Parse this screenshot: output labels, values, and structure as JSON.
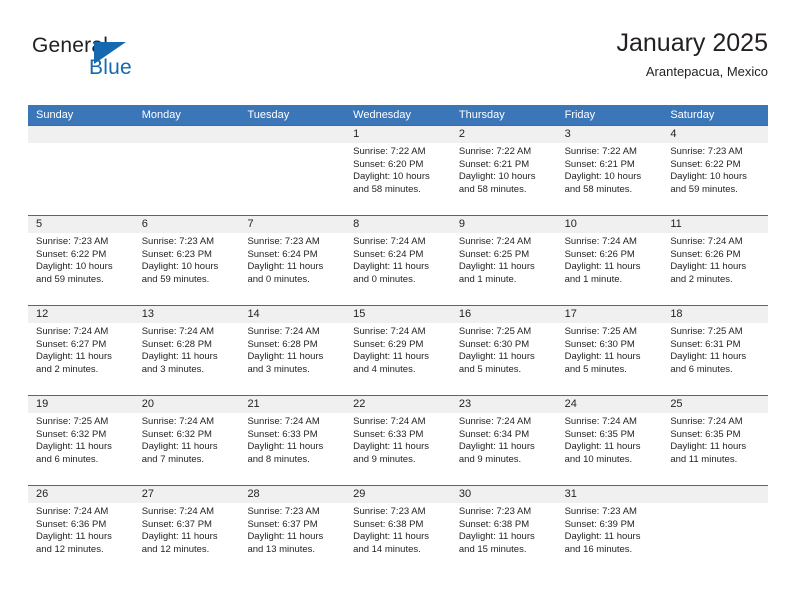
{
  "logo": {
    "text_top": "General",
    "text_bottom": "Blue",
    "triangle_icon": "triangle-icon",
    "brand_color": "#1668b0"
  },
  "header": {
    "title": "January 2025",
    "subtitle": "Arantepacua, Mexico"
  },
  "colors": {
    "header_blue": "#3a76b8",
    "row_divider_blue": "#2f6fb0",
    "day_band_gray": "#f0f0f0",
    "text": "#231f20"
  },
  "weekdays": [
    "Sunday",
    "Monday",
    "Tuesday",
    "Wednesday",
    "Thursday",
    "Friday",
    "Saturday"
  ],
  "weeks": [
    [
      {
        "day": "",
        "sunrise": "",
        "sunset": "",
        "daylight_line1": "",
        "daylight_line2": "",
        "empty": true
      },
      {
        "day": "",
        "sunrise": "",
        "sunset": "",
        "daylight_line1": "",
        "daylight_line2": "",
        "empty": true
      },
      {
        "day": "",
        "sunrise": "",
        "sunset": "",
        "daylight_line1": "",
        "daylight_line2": "",
        "empty": true
      },
      {
        "day": "1",
        "sunrise": "Sunrise: 7:22 AM",
        "sunset": "Sunset: 6:20 PM",
        "daylight_line1": "Daylight: 10 hours",
        "daylight_line2": "and 58 minutes.",
        "empty": false
      },
      {
        "day": "2",
        "sunrise": "Sunrise: 7:22 AM",
        "sunset": "Sunset: 6:21 PM",
        "daylight_line1": "Daylight: 10 hours",
        "daylight_line2": "and 58 minutes.",
        "empty": false
      },
      {
        "day": "3",
        "sunrise": "Sunrise: 7:22 AM",
        "sunset": "Sunset: 6:21 PM",
        "daylight_line1": "Daylight: 10 hours",
        "daylight_line2": "and 58 minutes.",
        "empty": false
      },
      {
        "day": "4",
        "sunrise": "Sunrise: 7:23 AM",
        "sunset": "Sunset: 6:22 PM",
        "daylight_line1": "Daylight: 10 hours",
        "daylight_line2": "and 59 minutes.",
        "empty": false
      }
    ],
    [
      {
        "day": "5",
        "sunrise": "Sunrise: 7:23 AM",
        "sunset": "Sunset: 6:22 PM",
        "daylight_line1": "Daylight: 10 hours",
        "daylight_line2": "and 59 minutes.",
        "empty": false
      },
      {
        "day": "6",
        "sunrise": "Sunrise: 7:23 AM",
        "sunset": "Sunset: 6:23 PM",
        "daylight_line1": "Daylight: 10 hours",
        "daylight_line2": "and 59 minutes.",
        "empty": false
      },
      {
        "day": "7",
        "sunrise": "Sunrise: 7:23 AM",
        "sunset": "Sunset: 6:24 PM",
        "daylight_line1": "Daylight: 11 hours",
        "daylight_line2": "and 0 minutes.",
        "empty": false
      },
      {
        "day": "8",
        "sunrise": "Sunrise: 7:24 AM",
        "sunset": "Sunset: 6:24 PM",
        "daylight_line1": "Daylight: 11 hours",
        "daylight_line2": "and 0 minutes.",
        "empty": false
      },
      {
        "day": "9",
        "sunrise": "Sunrise: 7:24 AM",
        "sunset": "Sunset: 6:25 PM",
        "daylight_line1": "Daylight: 11 hours",
        "daylight_line2": "and 1 minute.",
        "empty": false
      },
      {
        "day": "10",
        "sunrise": "Sunrise: 7:24 AM",
        "sunset": "Sunset: 6:26 PM",
        "daylight_line1": "Daylight: 11 hours",
        "daylight_line2": "and 1 minute.",
        "empty": false
      },
      {
        "day": "11",
        "sunrise": "Sunrise: 7:24 AM",
        "sunset": "Sunset: 6:26 PM",
        "daylight_line1": "Daylight: 11 hours",
        "daylight_line2": "and 2 minutes.",
        "empty": false
      }
    ],
    [
      {
        "day": "12",
        "sunrise": "Sunrise: 7:24 AM",
        "sunset": "Sunset: 6:27 PM",
        "daylight_line1": "Daylight: 11 hours",
        "daylight_line2": "and 2 minutes.",
        "empty": false
      },
      {
        "day": "13",
        "sunrise": "Sunrise: 7:24 AM",
        "sunset": "Sunset: 6:28 PM",
        "daylight_line1": "Daylight: 11 hours",
        "daylight_line2": "and 3 minutes.",
        "empty": false
      },
      {
        "day": "14",
        "sunrise": "Sunrise: 7:24 AM",
        "sunset": "Sunset: 6:28 PM",
        "daylight_line1": "Daylight: 11 hours",
        "daylight_line2": "and 3 minutes.",
        "empty": false
      },
      {
        "day": "15",
        "sunrise": "Sunrise: 7:24 AM",
        "sunset": "Sunset: 6:29 PM",
        "daylight_line1": "Daylight: 11 hours",
        "daylight_line2": "and 4 minutes.",
        "empty": false
      },
      {
        "day": "16",
        "sunrise": "Sunrise: 7:25 AM",
        "sunset": "Sunset: 6:30 PM",
        "daylight_line1": "Daylight: 11 hours",
        "daylight_line2": "and 5 minutes.",
        "empty": false
      },
      {
        "day": "17",
        "sunrise": "Sunrise: 7:25 AM",
        "sunset": "Sunset: 6:30 PM",
        "daylight_line1": "Daylight: 11 hours",
        "daylight_line2": "and 5 minutes.",
        "empty": false
      },
      {
        "day": "18",
        "sunrise": "Sunrise: 7:25 AM",
        "sunset": "Sunset: 6:31 PM",
        "daylight_line1": "Daylight: 11 hours",
        "daylight_line2": "and 6 minutes.",
        "empty": false
      }
    ],
    [
      {
        "day": "19",
        "sunrise": "Sunrise: 7:25 AM",
        "sunset": "Sunset: 6:32 PM",
        "daylight_line1": "Daylight: 11 hours",
        "daylight_line2": "and 6 minutes.",
        "empty": false
      },
      {
        "day": "20",
        "sunrise": "Sunrise: 7:24 AM",
        "sunset": "Sunset: 6:32 PM",
        "daylight_line1": "Daylight: 11 hours",
        "daylight_line2": "and 7 minutes.",
        "empty": false
      },
      {
        "day": "21",
        "sunrise": "Sunrise: 7:24 AM",
        "sunset": "Sunset: 6:33 PM",
        "daylight_line1": "Daylight: 11 hours",
        "daylight_line2": "and 8 minutes.",
        "empty": false
      },
      {
        "day": "22",
        "sunrise": "Sunrise: 7:24 AM",
        "sunset": "Sunset: 6:33 PM",
        "daylight_line1": "Daylight: 11 hours",
        "daylight_line2": "and 9 minutes.",
        "empty": false
      },
      {
        "day": "23",
        "sunrise": "Sunrise: 7:24 AM",
        "sunset": "Sunset: 6:34 PM",
        "daylight_line1": "Daylight: 11 hours",
        "daylight_line2": "and 9 minutes.",
        "empty": false
      },
      {
        "day": "24",
        "sunrise": "Sunrise: 7:24 AM",
        "sunset": "Sunset: 6:35 PM",
        "daylight_line1": "Daylight: 11 hours",
        "daylight_line2": "and 10 minutes.",
        "empty": false
      },
      {
        "day": "25",
        "sunrise": "Sunrise: 7:24 AM",
        "sunset": "Sunset: 6:35 PM",
        "daylight_line1": "Daylight: 11 hours",
        "daylight_line2": "and 11 minutes.",
        "empty": false
      }
    ],
    [
      {
        "day": "26",
        "sunrise": "Sunrise: 7:24 AM",
        "sunset": "Sunset: 6:36 PM",
        "daylight_line1": "Daylight: 11 hours",
        "daylight_line2": "and 12 minutes.",
        "empty": false
      },
      {
        "day": "27",
        "sunrise": "Sunrise: 7:24 AM",
        "sunset": "Sunset: 6:37 PM",
        "daylight_line1": "Daylight: 11 hours",
        "daylight_line2": "and 12 minutes.",
        "empty": false
      },
      {
        "day": "28",
        "sunrise": "Sunrise: 7:23 AM",
        "sunset": "Sunset: 6:37 PM",
        "daylight_line1": "Daylight: 11 hours",
        "daylight_line2": "and 13 minutes.",
        "empty": false
      },
      {
        "day": "29",
        "sunrise": "Sunrise: 7:23 AM",
        "sunset": "Sunset: 6:38 PM",
        "daylight_line1": "Daylight: 11 hours",
        "daylight_line2": "and 14 minutes.",
        "empty": false
      },
      {
        "day": "30",
        "sunrise": "Sunrise: 7:23 AM",
        "sunset": "Sunset: 6:38 PM",
        "daylight_line1": "Daylight: 11 hours",
        "daylight_line2": "and 15 minutes.",
        "empty": false
      },
      {
        "day": "31",
        "sunrise": "Sunrise: 7:23 AM",
        "sunset": "Sunset: 6:39 PM",
        "daylight_line1": "Daylight: 11 hours",
        "daylight_line2": "and 16 minutes.",
        "empty": false
      },
      {
        "day": "",
        "sunrise": "",
        "sunset": "",
        "daylight_line1": "",
        "daylight_line2": "",
        "empty": true
      }
    ]
  ]
}
